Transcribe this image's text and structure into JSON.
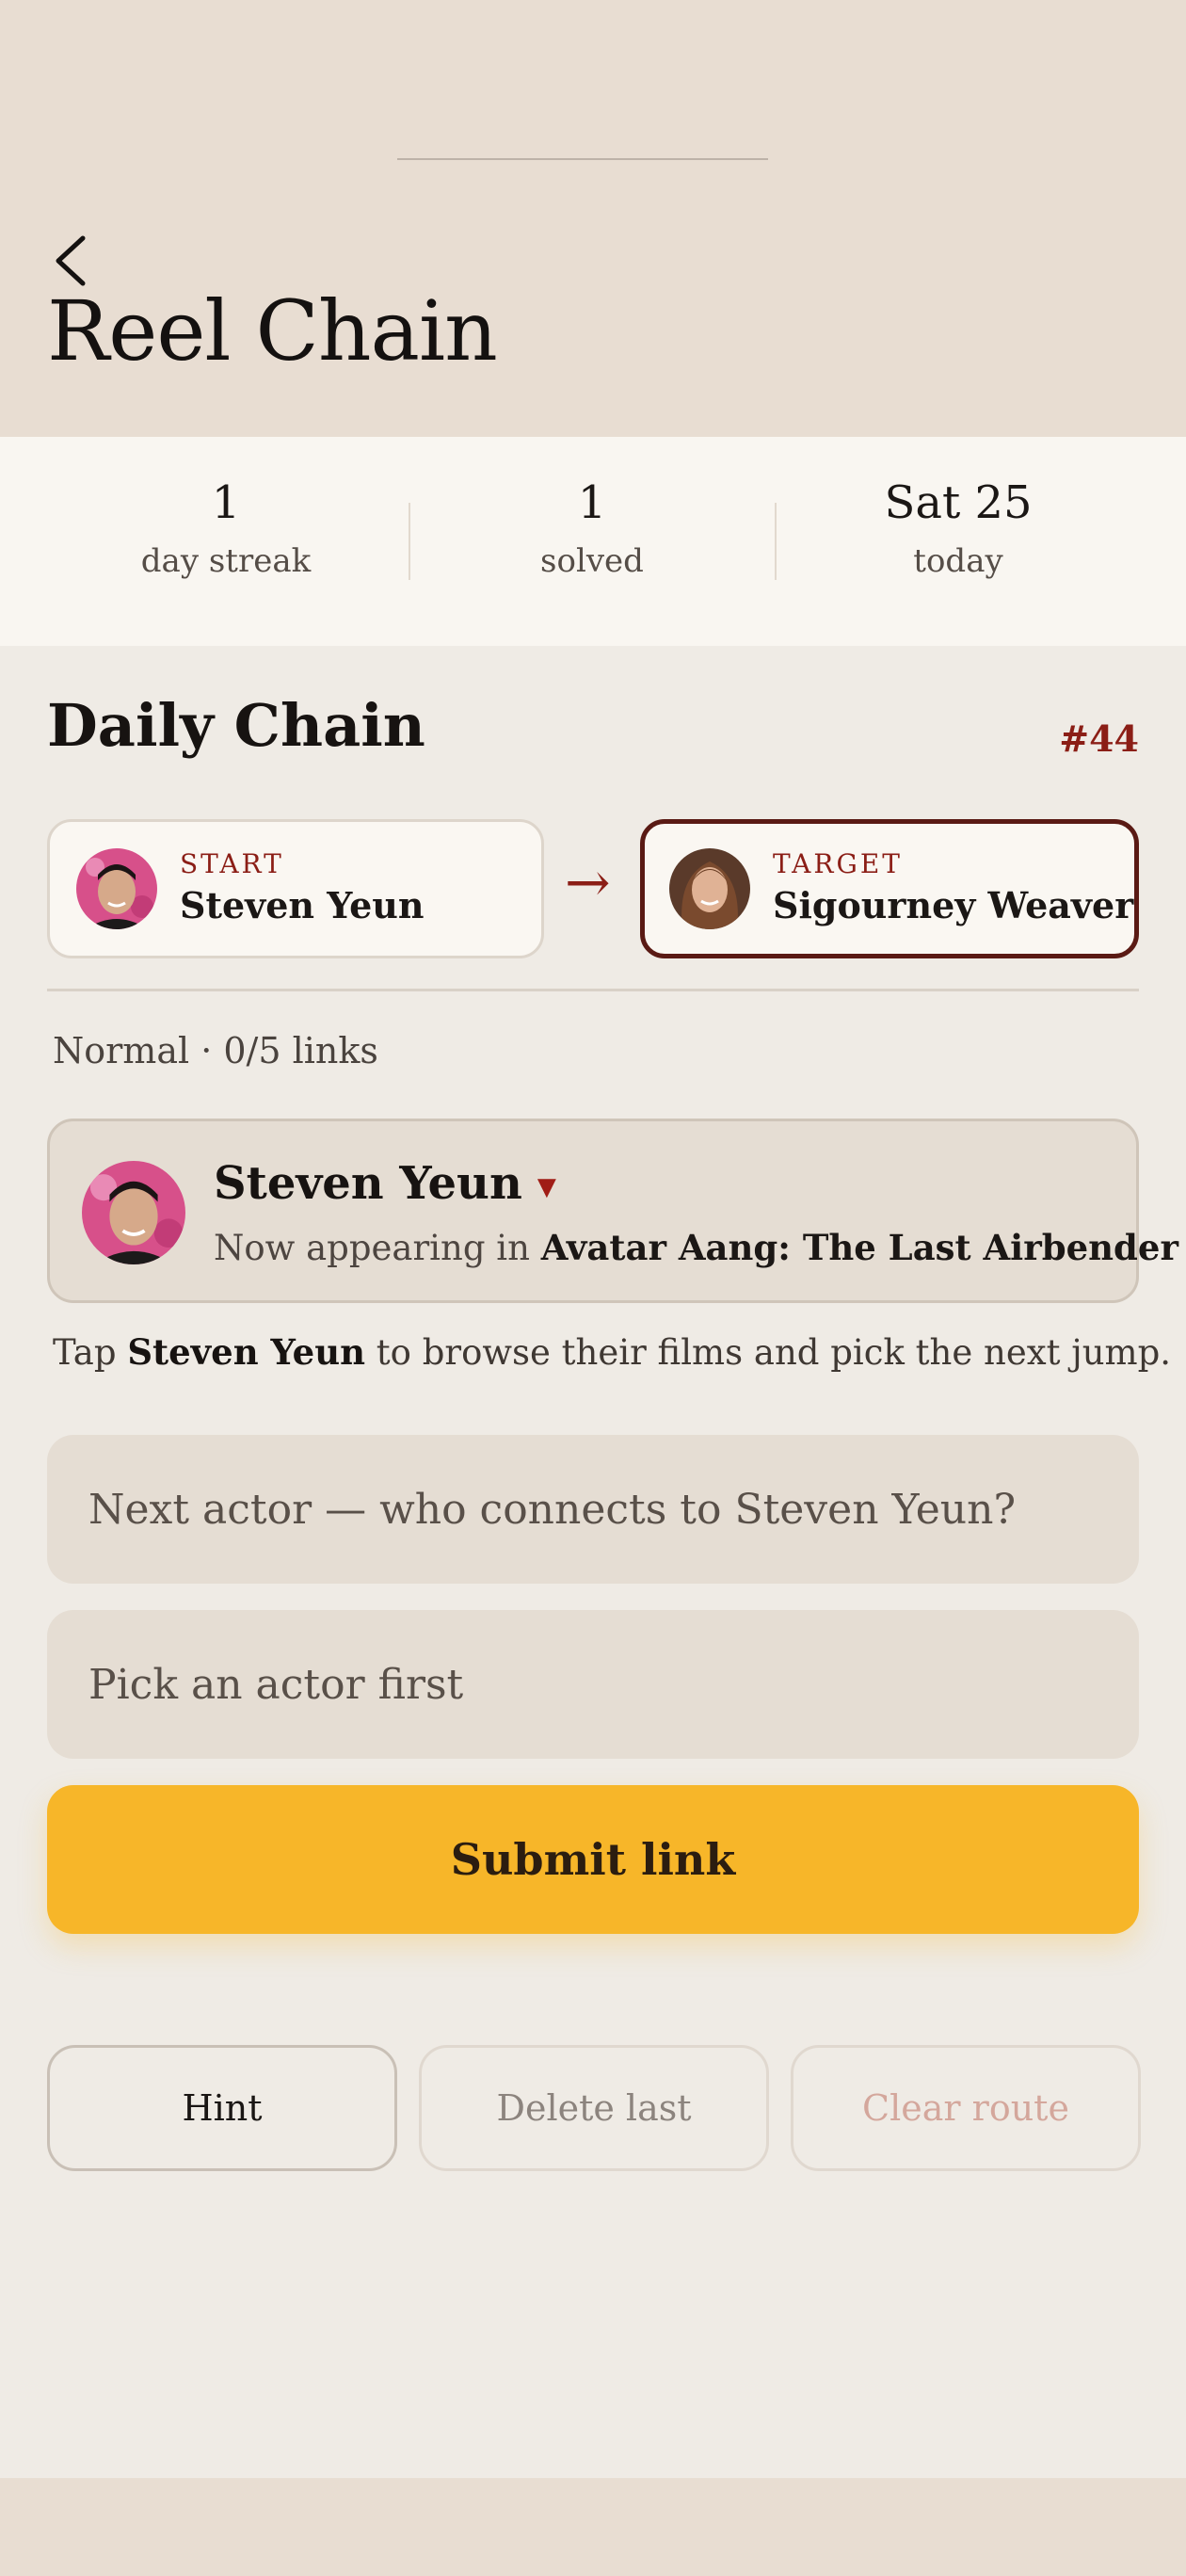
{
  "header": {
    "title": "Reel Chain",
    "back_icon": "chevron-left-icon"
  },
  "stats": [
    {
      "value": "1",
      "label": "day streak"
    },
    {
      "value": "1",
      "label": "solved"
    },
    {
      "value": "Sat 25",
      "label": "today"
    }
  ],
  "daily": {
    "title": "Daily Chain",
    "puzzle_number": "#44",
    "start": {
      "tag": "START",
      "name": "Steven Yeun"
    },
    "target": {
      "tag": "TARGET",
      "name": "Sigourney Weaver"
    },
    "arrow": "→",
    "mode_text": "Normal · 0/5 links"
  },
  "current_actor": {
    "name": "Steven Yeun",
    "caret": "▼",
    "appearing_prefix": "Now appearing in ",
    "movie": "Avatar Aang: The Last Airbender"
  },
  "help": {
    "prefix": "Tap ",
    "actor": "Steven Yeun",
    "suffix": " to browse their films and pick the next jump."
  },
  "inputs": {
    "actor_placeholder": "Next actor — who connects to Steven Yeun?",
    "movie_placeholder": "Pick an actor first"
  },
  "actions": {
    "submit": "Submit link",
    "hint": "Hint",
    "delete_last": "Delete last",
    "clear_route": "Clear route"
  },
  "colors": {
    "accent_red": "#8b1e16",
    "submit_yellow": "#f7b629",
    "target_border": "#5a1a14"
  }
}
